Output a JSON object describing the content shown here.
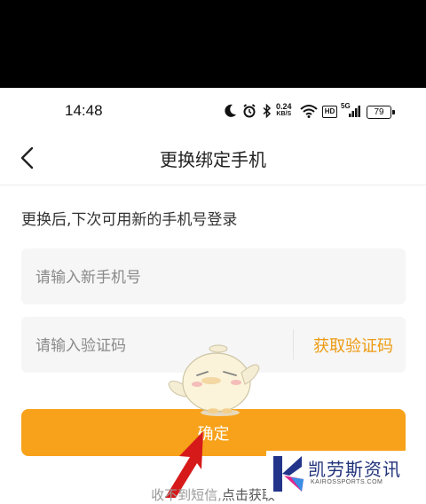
{
  "status_bar": {
    "time": "14:48",
    "net_speed_value": "0.24",
    "net_speed_unit": "KB/S",
    "hd_badge": "HD",
    "signal_label": "5G",
    "battery": "79",
    "icons": [
      "moon-icon",
      "alarm-icon",
      "bluetooth-icon",
      "wifi-icon",
      "signal-icon",
      "battery-icon"
    ]
  },
  "nav": {
    "title": "更换绑定手机",
    "back_icon": "chevron-left-icon"
  },
  "form": {
    "hint": "更换后,下次可用新的手机号登录",
    "phone_placeholder": "请输入新手机号",
    "code_placeholder": "请输入验证码",
    "get_code_label": "获取验证码",
    "confirm_label": "确定"
  },
  "footer": {
    "hint_prefix": "收不到短信",
    "hint_link": "点击获取"
  },
  "watermark": {
    "name": "凯劳斯资讯",
    "domain": "KAIROSSPORTS.COM"
  },
  "colors": {
    "accent": "#f7a21a",
    "link": "#ed9a12",
    "field_bg": "#f6f6f6",
    "top_band": "#000000"
  }
}
